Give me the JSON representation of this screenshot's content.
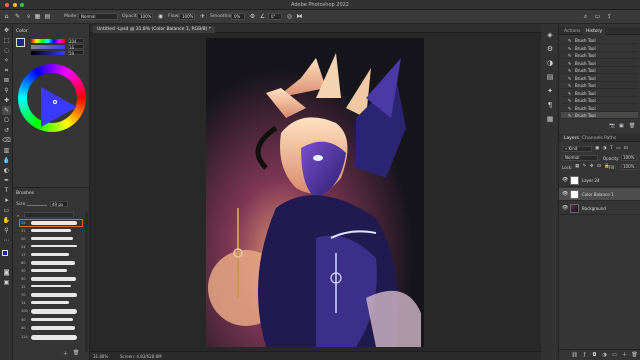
{
  "window": {
    "title": "Adobe Photoshop 2022"
  },
  "options_bar": {
    "mode_label": "Mode:",
    "mode_value": "Normal",
    "opacity_label": "Opacity:",
    "opacity_value": "100%",
    "flow_label": "Flow:",
    "flow_value": "100%",
    "smoothing_label": "Smoothing:",
    "smoothing_value": "0%",
    "angle_value": "0°",
    "brush_size": "9"
  },
  "color_panel": {
    "tab": "Color",
    "values": [
      "204",
      "16",
      "59"
    ]
  },
  "brushes_panel": {
    "tab": "Brushes",
    "size_label": "Size:",
    "size_value": "49 px",
    "brush_sizes": [
      "25",
      "31",
      "20",
      "24",
      "17",
      "80",
      "30",
      "50",
      "12",
      "70",
      "14",
      "100",
      "30",
      "40",
      "124"
    ]
  },
  "document": {
    "tab_label": "Untitled -Lpsd @ 31.8% (Color Balance 1, RGB/8) *",
    "zoom": "31.88%",
    "status": "Screen: 4.83/628.8M"
  },
  "history_panel": {
    "tabs": [
      "Actions",
      "History"
    ],
    "active_tab": "History",
    "items": [
      "Brush Tool",
      "Brush Tool",
      "Brush Tool",
      "Brush Tool",
      "Brush Tool",
      "Brush Tool",
      "Brush Tool",
      "Brush Tool",
      "Brush Tool",
      "Brush Tool",
      "Brush Tool"
    ]
  },
  "layers_panel": {
    "tabs": [
      "Layers",
      "Channels",
      "Paths"
    ],
    "active_tab": "Layers",
    "filter_kind": "Kind",
    "blend_mode": "Normal",
    "opacity_label": "Opacity:",
    "opacity_value": "100%",
    "fill_label": "Fill:",
    "fill_value": "100%",
    "lock_label": "Lock:",
    "layers": [
      "Layer 24",
      "Color Balance 1",
      "Background"
    ]
  }
}
